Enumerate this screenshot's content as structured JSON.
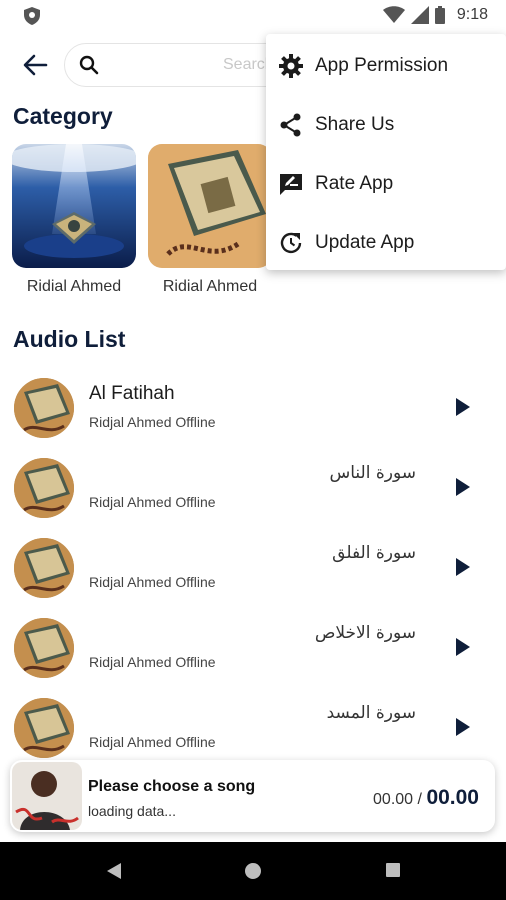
{
  "status_bar": {
    "time": "9:18"
  },
  "search": {
    "placeholder": "Search"
  },
  "sections": {
    "category": "Category",
    "audio_list": "Audio List"
  },
  "categories": [
    {
      "label": "Ridial Ahmed"
    },
    {
      "label": "Ridial Ahmed"
    }
  ],
  "audio_list": [
    {
      "title": "Al Fatihah",
      "subtitle": "Ridjal Ahmed Offline"
    },
    {
      "title": "سورة الناس",
      "subtitle": "Ridjal Ahmed Offline"
    },
    {
      "title": "سورة الفلق",
      "subtitle": "Ridjal Ahmed Offline"
    },
    {
      "title": "سورة الاخلاص",
      "subtitle": "Ridjal Ahmed Offline"
    },
    {
      "title": "سورة المسد",
      "subtitle": "Ridjal Ahmed Offline"
    }
  ],
  "player": {
    "title": "Please choose a song",
    "status": "loading data...",
    "current_time": "00.00",
    "separator": "/",
    "total_time": "00.00"
  },
  "menu": {
    "items": [
      {
        "label": "App Permission",
        "icon": "gear-icon"
      },
      {
        "label": "Share Us",
        "icon": "share-icon"
      },
      {
        "label": "Rate App",
        "icon": "rate-icon"
      },
      {
        "label": "Update App",
        "icon": "update-icon"
      }
    ]
  },
  "colors": {
    "accent": "#0f1e3a"
  }
}
